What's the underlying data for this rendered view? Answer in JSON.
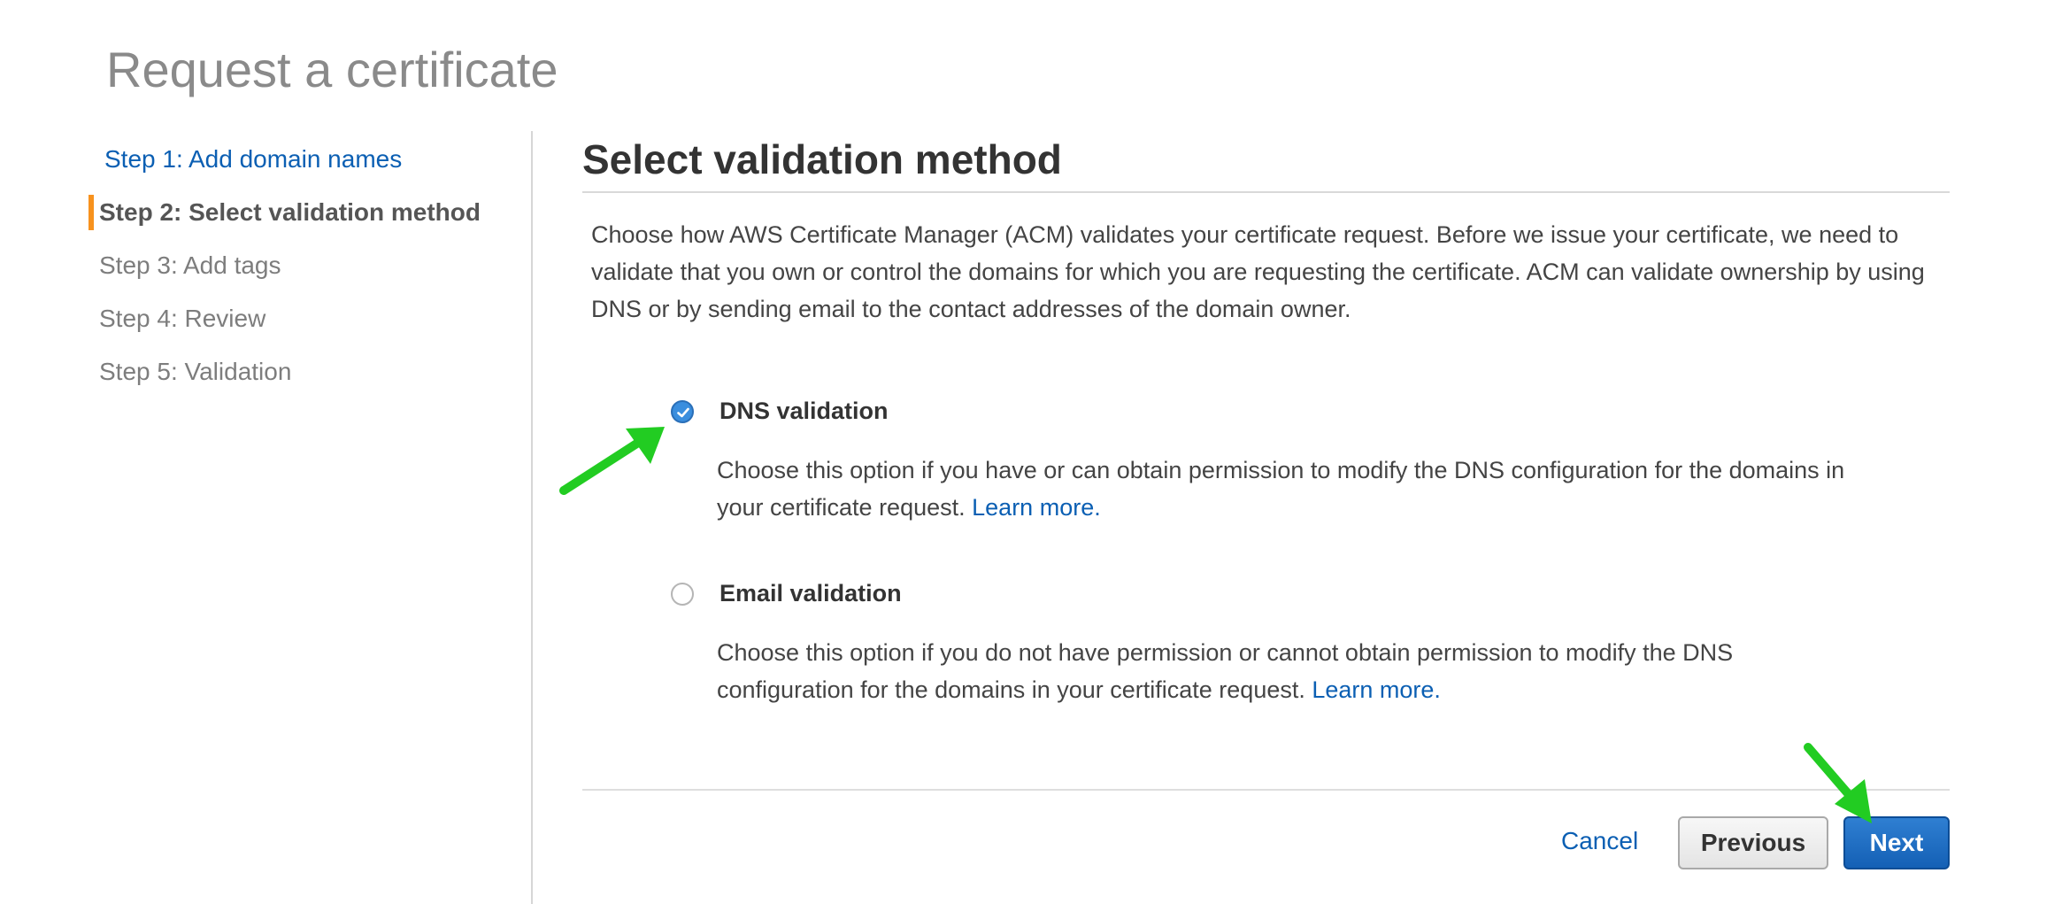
{
  "page": {
    "title": "Request a certificate"
  },
  "sidebar": {
    "steps": [
      {
        "label": "Step 1: Add domain names",
        "state": "link"
      },
      {
        "label": "Step 2: Select validation method",
        "state": "active"
      },
      {
        "label": "Step 3: Add tags",
        "state": "disabled"
      },
      {
        "label": "Step 4: Review",
        "state": "disabled"
      },
      {
        "label": "Step 5: Validation",
        "state": "disabled"
      }
    ]
  },
  "main": {
    "section_title": "Select validation method",
    "description": "Choose how AWS Certificate Manager (ACM) validates your certificate request. Before we issue your certificate, we need to validate that you own or control the domains for which you are requesting the certificate. ACM can validate ownership by using DNS or by sending email to the contact addresses of the domain owner.",
    "options": [
      {
        "label": "DNS validation",
        "selected": true,
        "description": "Choose this option if you have or can obtain permission to modify the DNS configuration for the domains in your certificate request.",
        "learn_more": "Learn more."
      },
      {
        "label": "Email validation",
        "selected": false,
        "description": "Choose this option if you do not have permission or cannot obtain permission to modify the DNS configuration for the domains in your certificate request.",
        "learn_more": "Learn more."
      }
    ]
  },
  "footer": {
    "cancel_label": "Cancel",
    "previous_label": "Previous",
    "next_label": "Next"
  },
  "colors": {
    "accent_link": "#0b5fb3",
    "active_step_marker": "#f7921e",
    "primary_button": "#1a6ac3",
    "annotation_arrow": "#22cc22"
  },
  "icons": {
    "radio_checked": "check-circle-icon",
    "radio_unchecked": "radio-empty-icon",
    "annotation": "green-arrow-icon"
  }
}
